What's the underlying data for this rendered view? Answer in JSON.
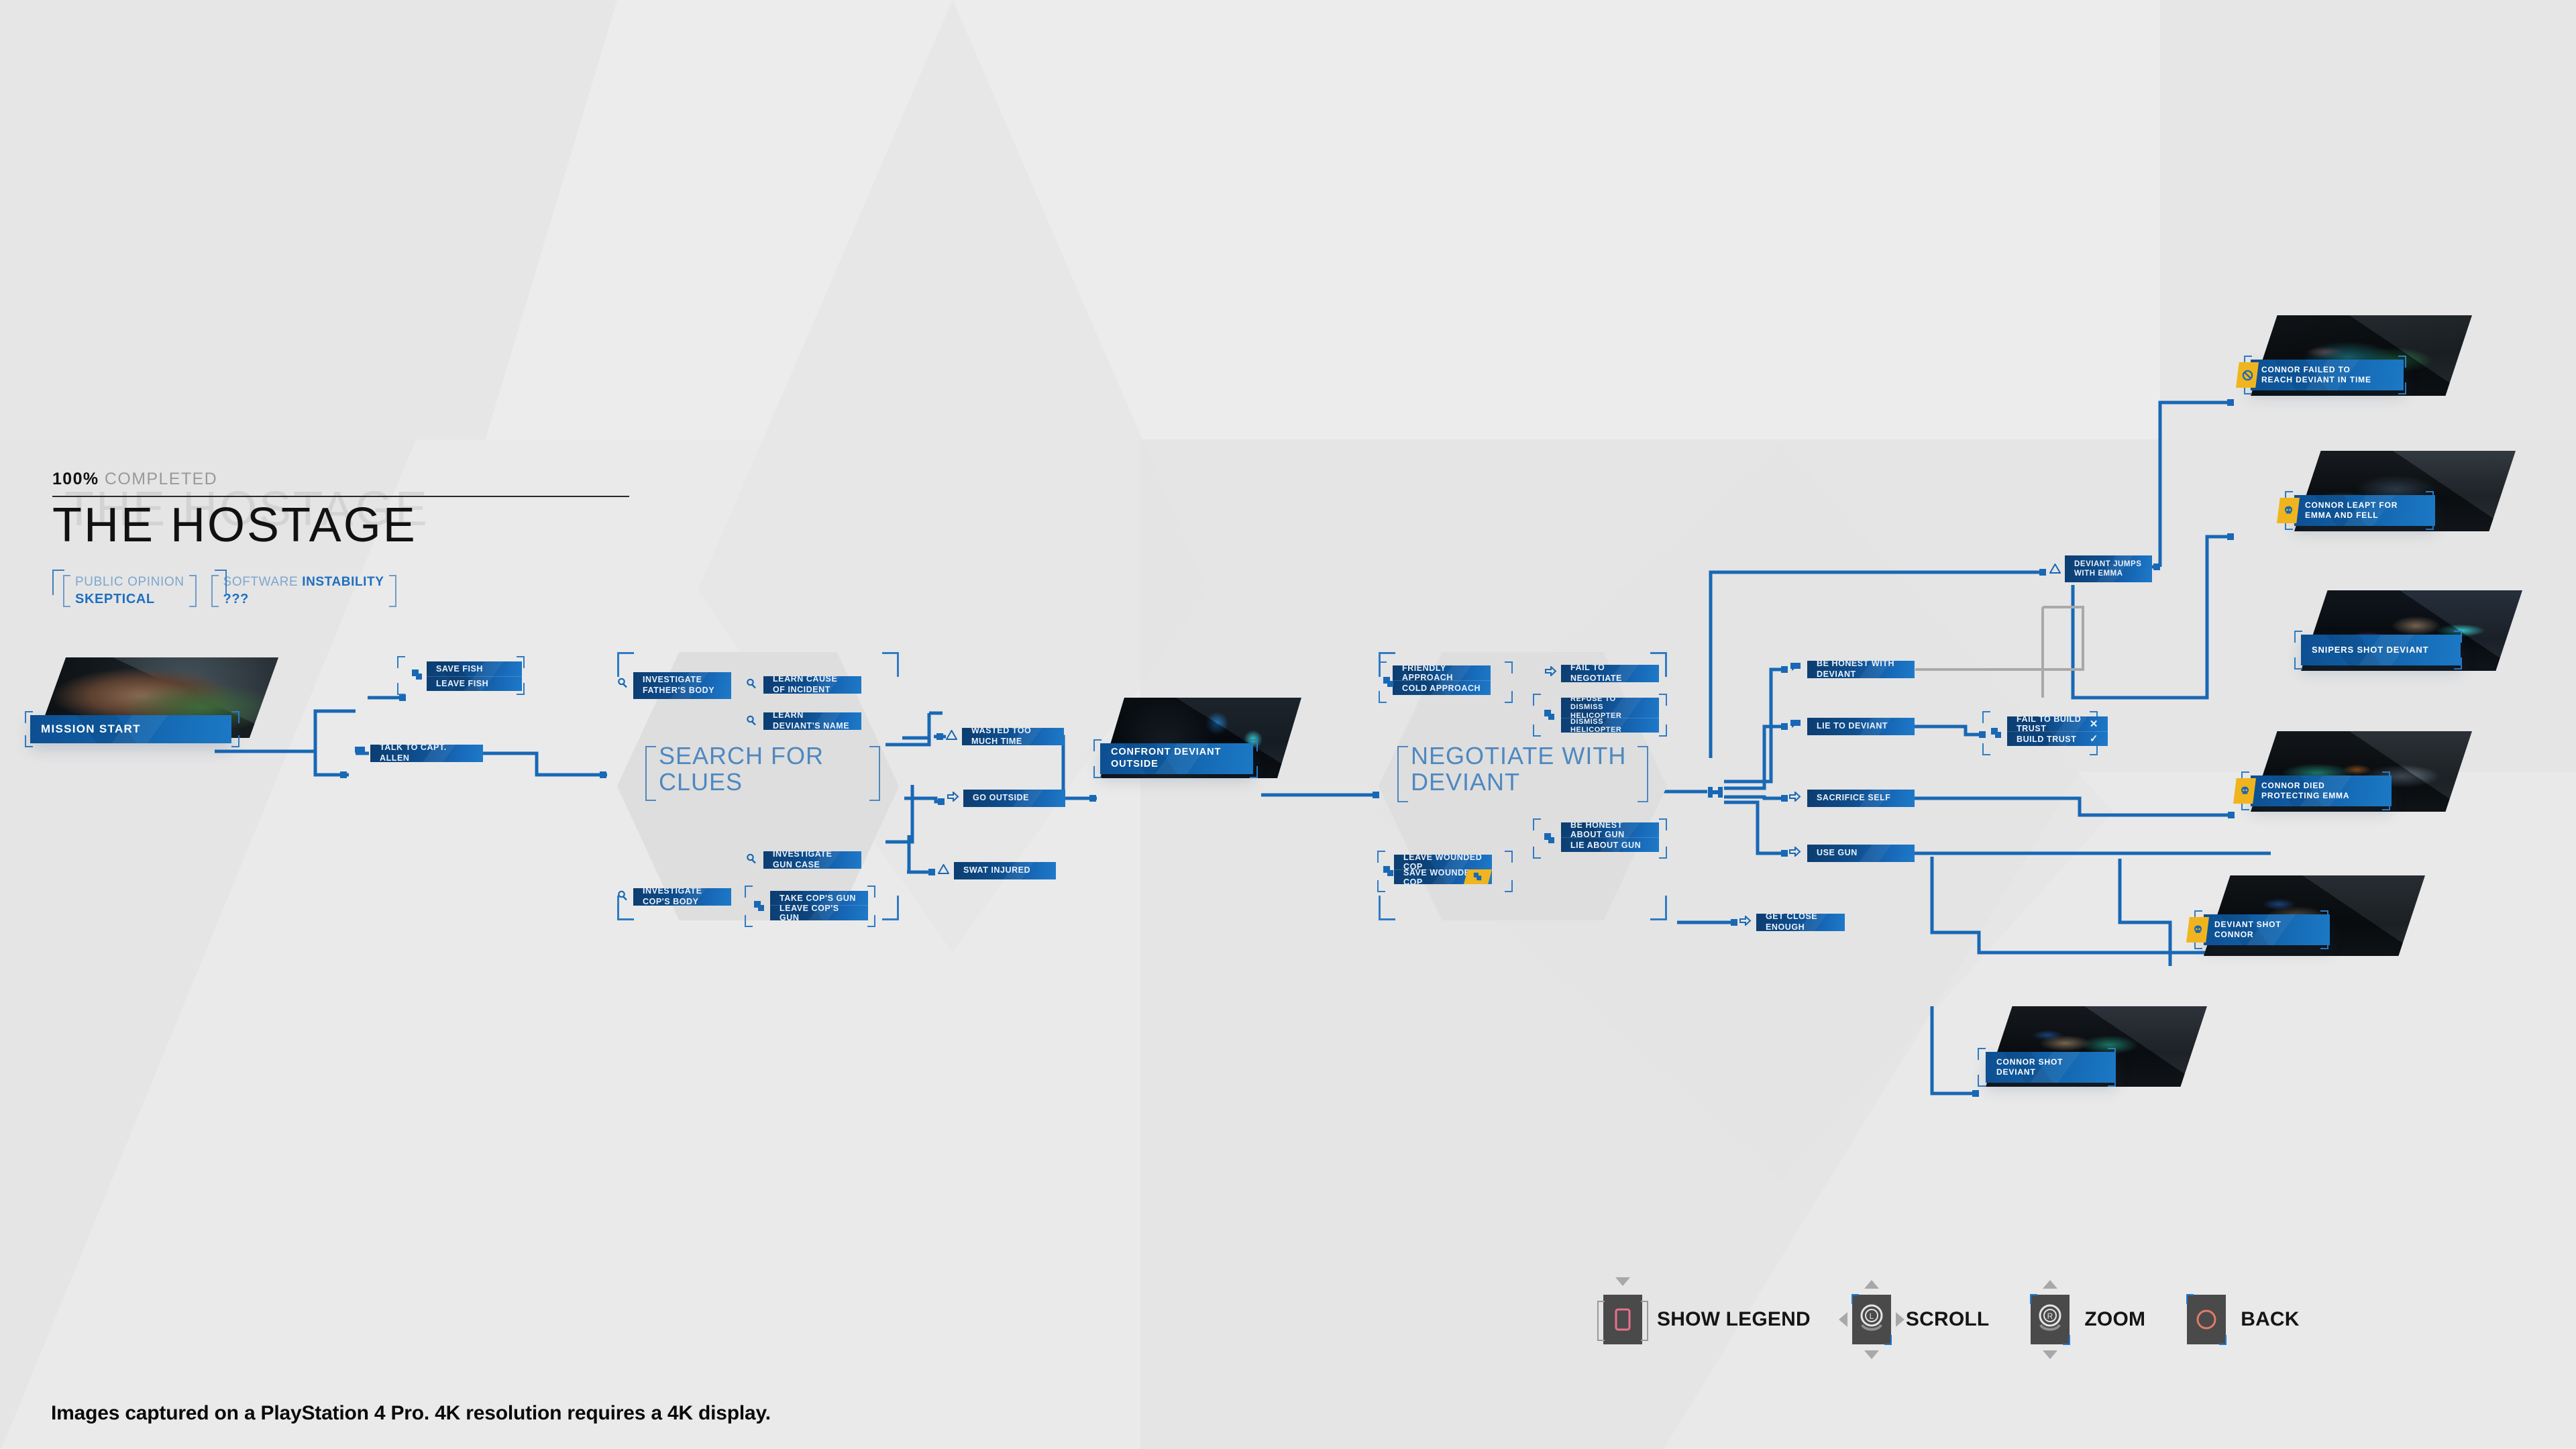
{
  "header": {
    "percent": "100%",
    "completed_label": "COMPLETED",
    "title": "THE HOSTAGE",
    "stats": [
      {
        "label_prefix": "PUBLIC OPINION",
        "label_strong": "",
        "value": "SKEPTICAL"
      },
      {
        "label_prefix": "SOFTWARE ",
        "label_strong": "INSTABILITY",
        "value": "???"
      }
    ]
  },
  "scenes": [
    {
      "id": "search-for-clues",
      "label": "SEARCH FOR\nCLUES"
    },
    {
      "id": "negotiate-with-deviant",
      "label": "NEGOTIATE WITH\nDEVIANT"
    }
  ],
  "picture_nodes": [
    {
      "id": "mission-start",
      "caption": "MISSION  START",
      "badge": "none"
    },
    {
      "id": "confront-deviant-outside",
      "caption": "CONFRONT DEVIANT\nOUTSIDE",
      "badge": "none"
    },
    {
      "id": "connor-failed-to-reach-deviant-in-time",
      "caption": "CONNOR FAILED TO\nREACH DEVIANT IN TIME",
      "badge": "prohibited"
    },
    {
      "id": "connor-leapt-for-emma-and-fell",
      "caption": "CONNOR LEAPT FOR\nEMMA AND FELL",
      "badge": "skull"
    },
    {
      "id": "snipers-shot-deviant",
      "caption": "SNIPERS SHOT DEVIANT",
      "badge": "none"
    },
    {
      "id": "connor-died-protecting-emma",
      "caption": "CONNOR DIED\nPROTECTING EMMA",
      "badge": "skull"
    },
    {
      "id": "deviant-shot-connor",
      "caption": "DEVIANT SHOT\nCONNOR",
      "badge": "skull"
    },
    {
      "id": "connor-shot-deviant",
      "caption": "CONNOR SHOT\nDEVIANT",
      "badge": "none"
    }
  ],
  "nodes": [
    {
      "id": "save-fish",
      "label": "SAVE FISH",
      "marker": "choice"
    },
    {
      "id": "leave-fish",
      "label": "LEAVE FISH",
      "marker": "choice"
    },
    {
      "id": "talk-to-capt-allen",
      "label": "TALK TO CAPT. ALLEN",
      "marker": "dialogue"
    },
    {
      "id": "investigate-fathers-body",
      "label": "INVESTIGATE FATHER'S BODY",
      "marker": "investigate"
    },
    {
      "id": "learn-cause-of-incident",
      "label": "LEARN CAUSE OF INCIDENT",
      "marker": "investigate"
    },
    {
      "id": "learn-deviants-name",
      "label": "LEARN DEVIANT'S NAME",
      "marker": "investigate"
    },
    {
      "id": "investigate-gun-case",
      "label": "INVESTIGATE GUN CASE",
      "marker": "investigate"
    },
    {
      "id": "investigate-cops-body",
      "label": "INVESTIGATE COP'S BODY",
      "marker": "investigate"
    },
    {
      "id": "take-cops-gun",
      "label": "TAKE COP'S GUN",
      "marker": "choice"
    },
    {
      "id": "leave-cops-gun",
      "label": "LEAVE COP'S GUN",
      "marker": "choice"
    },
    {
      "id": "wasted-too-much-time",
      "label": "WASTED TOO MUCH TIME",
      "marker": "warning"
    },
    {
      "id": "go-outside",
      "label": "GO OUTSIDE",
      "marker": "action"
    },
    {
      "id": "swat-injured",
      "label": "SWAT INJURED",
      "marker": "warning"
    },
    {
      "id": "friendly-approach",
      "label": "FRIENDLY APPROACH",
      "marker": "choice"
    },
    {
      "id": "cold-approach",
      "label": "COLD APPROACH",
      "marker": "choice"
    },
    {
      "id": "fail-to-negotiate",
      "label": "FAIL TO NEGOTIATE",
      "marker": "action"
    },
    {
      "id": "refuse-to-dismiss-helicopter",
      "label": "REFUSE TO DISMISS HELICOPTER",
      "marker": "choice"
    },
    {
      "id": "dismiss-helicopter",
      "label": "DISMISS HELICOPTER",
      "marker": "choice"
    },
    {
      "id": "be-honest-about-gun",
      "label": "BE HONEST ABOUT GUN",
      "marker": "choice"
    },
    {
      "id": "lie-about-gun",
      "label": "LIE ABOUT GUN",
      "marker": "choice"
    },
    {
      "id": "leave-wounded-cop",
      "label": "LEAVE WOUNDED COP",
      "marker": "choice"
    },
    {
      "id": "save-wounded-cop",
      "label": "SAVE WOUNDED COP",
      "marker": "choice"
    },
    {
      "id": "be-honest-with-deviant",
      "label": "BE HONEST WITH DEVIANT",
      "marker": "dialogue"
    },
    {
      "id": "lie-to-deviant",
      "label": "LIE TO DEVIANT",
      "marker": "dialogue"
    },
    {
      "id": "fail-to-build-trust",
      "label": "FAIL TO BUILD TRUST",
      "marker": "choice",
      "result": "fail"
    },
    {
      "id": "build-trust",
      "label": "BUILD TRUST",
      "marker": "choice",
      "result": "success"
    },
    {
      "id": "sacrifice-self",
      "label": "SACRIFICE SELF",
      "marker": "action"
    },
    {
      "id": "use-gun",
      "label": "USE GUN",
      "marker": "action"
    },
    {
      "id": "get-close-enough",
      "label": "GET CLOSE ENOUGH",
      "marker": "action"
    },
    {
      "id": "deviant-jumps-with-emma",
      "label": "DEVIANT JUMPS WITH EMMA",
      "marker": "warning"
    }
  ],
  "controls": [
    {
      "id": "show-legend",
      "label": "SHOW LEGEND",
      "icon": "square-button"
    },
    {
      "id": "scroll",
      "label": "SCROLL",
      "icon": "left-stick"
    },
    {
      "id": "zoom",
      "label": "ZOOM",
      "icon": "right-stick"
    },
    {
      "id": "back",
      "label": "BACK",
      "icon": "circle-button"
    }
  ],
  "footer": {
    "note": "Images captured on a PlayStation 4 Pro. 4K resolution requires a 4K display."
  },
  "colors": {
    "accent_blue": "#1d6fc0",
    "node_dark": "#0c3d70",
    "node_light": "#1e7ac9",
    "badge_yellow": "#f0b51e",
    "bg": "#e9e9e9",
    "square_pink": "#e8718f",
    "circle_red": "#e07a6a"
  }
}
